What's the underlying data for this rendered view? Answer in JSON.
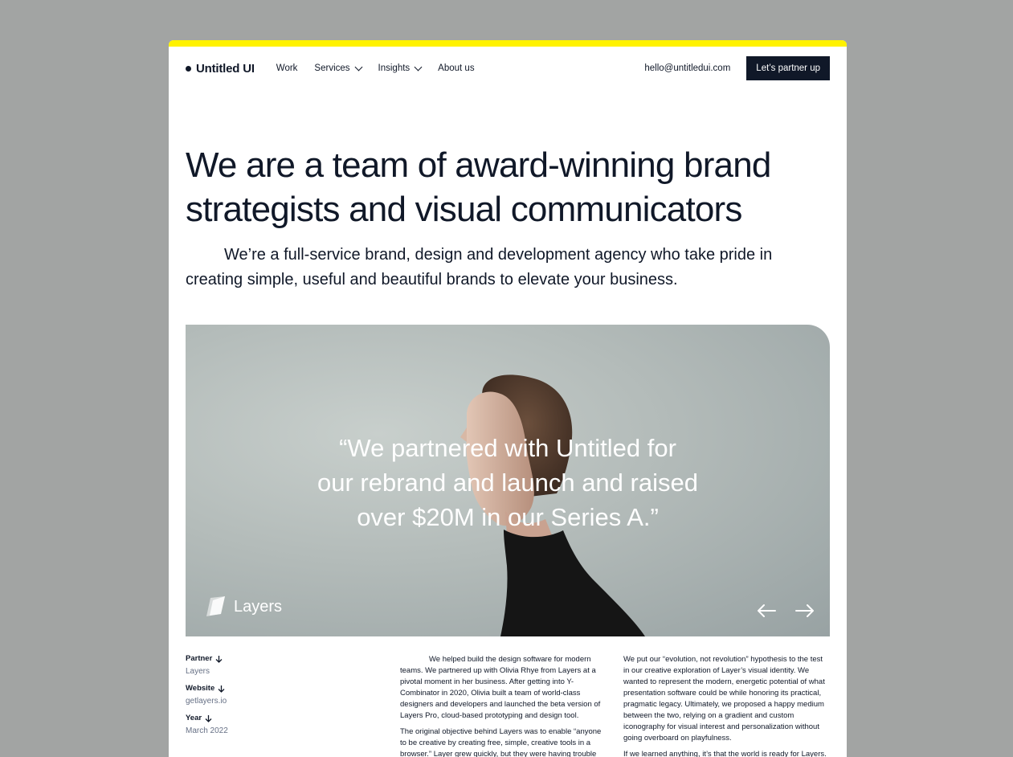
{
  "nav": {
    "logo": "Untitled UI",
    "links": [
      {
        "label": "Work",
        "dropdown": false
      },
      {
        "label": "Services",
        "dropdown": true
      },
      {
        "label": "Insights",
        "dropdown": true
      },
      {
        "label": "About us",
        "dropdown": false
      }
    ],
    "email": "hello@untitledui.com",
    "cta": "Let’s partner up"
  },
  "hero": {
    "title": "We are a team of award-winning brand strategists and visual communicators",
    "subtitle": "We’re a full-service brand, design and development agency who take pride in creating simple, useful and beautiful brands to elevate your business."
  },
  "testimonial": {
    "quote_lines": [
      "“We partnered with Untitled for",
      "our rebrand and launch and raised",
      "over $20M in our Series A.”"
    ],
    "company": "Layers"
  },
  "project_meta": [
    {
      "label": "Partner",
      "value": "Layers"
    },
    {
      "label": "Website",
      "value": "getlayers.io"
    },
    {
      "label": "Year",
      "value": "March 2022"
    }
  ],
  "body_col1": [
    "We helped build the design software for modern teams. We partnered up with Olivia Rhye from Layers at a pivotal moment in her business. After getting into Y-Combinator in 2020, Olivia built a team of world-class designers and developers and launched the beta version of Layers Pro, cloud-based prototyping and design tool.",
    "The original objective behind Layers was to enable “anyone to be creative by creating free, simple, creative tools in a browser.” Layer grew quickly, but they were having trouble"
  ],
  "body_col2": [
    "We put our “evolution, not revolution” hypothesis to the test in our creative exploration of Layer’s visual identity. We wanted to represent the modern, energetic potential of what presentation software could be while honoring its practical, pragmatic legacy. Ultimately, we proposed a happy medium between the two, relying on a gradient and custom iconography for visual interest and personalization without going overboard on playfulness.",
    "If we learned anything, it’s that the world is ready for Layers."
  ],
  "colors": {
    "accent_bar": "#fff200",
    "ink": "#101828",
    "muted": "#667085",
    "backdrop": "#a2a4a3"
  },
  "icons": [
    "chevron-down-icon",
    "arrow-down-icon",
    "arrow-left-icon",
    "arrow-right-icon",
    "layers-logo-icon"
  ]
}
